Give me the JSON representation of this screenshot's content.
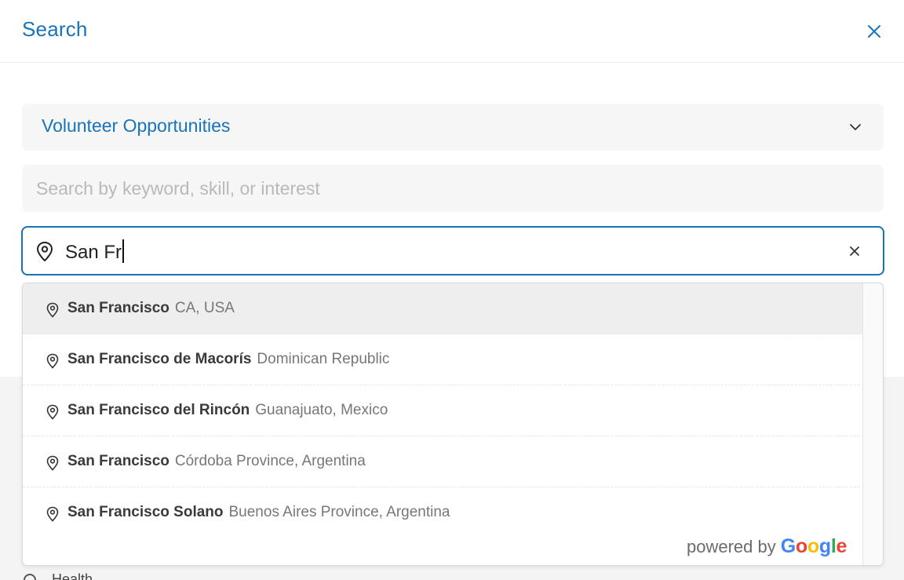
{
  "header": {
    "title": "Search"
  },
  "category": {
    "selected": "Volunteer Opportunities"
  },
  "keyword": {
    "placeholder": "Search by keyword, skill, or interest",
    "value": ""
  },
  "location": {
    "value": "San Fr"
  },
  "suggestions": [
    {
      "main": "San Francisco",
      "secondary": "CA, USA"
    },
    {
      "main": "San Francisco de Macorís",
      "secondary": "Dominican Republic"
    },
    {
      "main": "San Francisco del Rincón",
      "secondary": "Guanajuato, Mexico"
    },
    {
      "main": "San Francisco",
      "secondary": "Córdoba Province, Argentina"
    },
    {
      "main": "San Francisco Solano",
      "secondary": "Buenos Aires Province, Argentina"
    }
  ],
  "attribution": {
    "prefix": "powered by",
    "brand": "Google"
  },
  "background": {
    "peek_label": "Health"
  },
  "colors": {
    "accent": "#1a73b8",
    "field_bg": "#f6f6f6",
    "active_row": "#eeeeee"
  },
  "icons": {
    "close": "close-icon",
    "chevron": "chevron-down-icon",
    "pin": "map-pin-icon",
    "clear": "clear-icon"
  }
}
